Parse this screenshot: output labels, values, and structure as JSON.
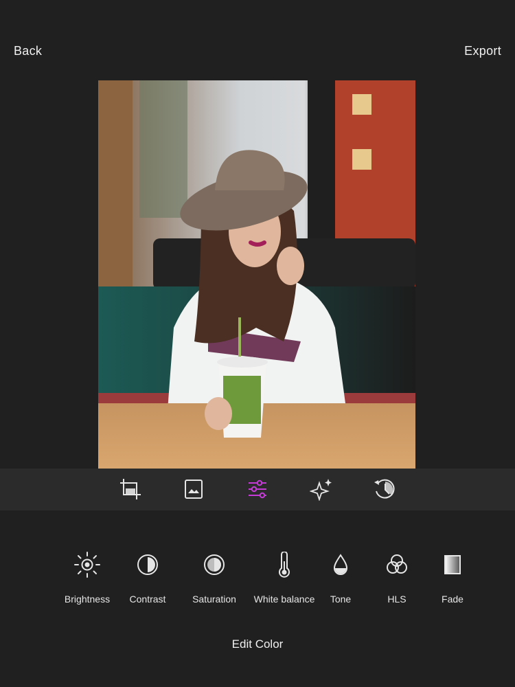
{
  "nav": {
    "back_label": "Back",
    "export_label": "Export"
  },
  "toolbar": {
    "tools": [
      "crop",
      "image",
      "adjust",
      "effects",
      "history"
    ],
    "active": "adjust",
    "accent_color": "#c43bd6"
  },
  "adjustments": [
    {
      "label": "Brightness",
      "icon": "brightness-icon"
    },
    {
      "label": "Contrast",
      "icon": "contrast-icon"
    },
    {
      "label": "Saturation",
      "icon": "saturation-icon"
    },
    {
      "label": "White balance",
      "icon": "thermometer-icon"
    },
    {
      "label": "Tone",
      "icon": "drop-icon"
    },
    {
      "label": "HLS",
      "icon": "hls-circles-icon"
    },
    {
      "label": "Fade",
      "icon": "fade-icon"
    }
  ],
  "footer": {
    "title": "Edit Color"
  }
}
